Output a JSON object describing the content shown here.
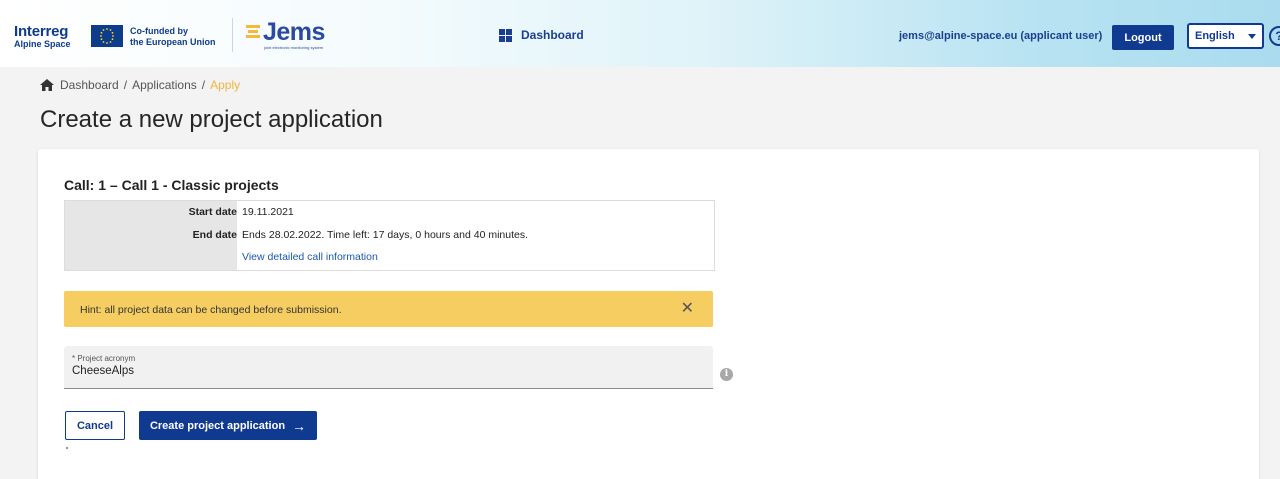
{
  "header": {
    "logo_title": "Interreg",
    "logo_subtitle": "Alpine Space",
    "cofunded_line1": "Co-funded by",
    "cofunded_line2": "the European Union",
    "app_name": "Jems",
    "app_tagline": "joint electronic monitoring system",
    "nav_dashboard": "Dashboard",
    "user": "jems@alpine-space.eu (applicant user)",
    "logout": "Logout",
    "language": "English",
    "help": "?"
  },
  "breadcrumb": {
    "items": [
      "Dashboard",
      "Applications",
      "Apply"
    ],
    "separator": "/"
  },
  "page_title": "Create a new project application",
  "call": {
    "title": "Call: 1 – Call 1 - Classic projects",
    "start_label": "Start date",
    "start_value": "19.11.2021",
    "end_label": "End date",
    "end_value": "Ends 28.02.2022. Time left: 17 days, 0 hours and 40 minutes.",
    "details_link": "View detailed call information"
  },
  "hint": {
    "text": "Hint: all project data can be changed before submission.",
    "close": "✕"
  },
  "form": {
    "acronym_label": "* Project acronym",
    "acronym_value": "CheeseAlps",
    "info": "i"
  },
  "actions": {
    "cancel": "Cancel",
    "create": "Create project application",
    "create_arrow": "→"
  },
  "colors": {
    "primary": "#103a8f",
    "accent": "#f2b53a",
    "hint_bg": "#f5cd60"
  }
}
